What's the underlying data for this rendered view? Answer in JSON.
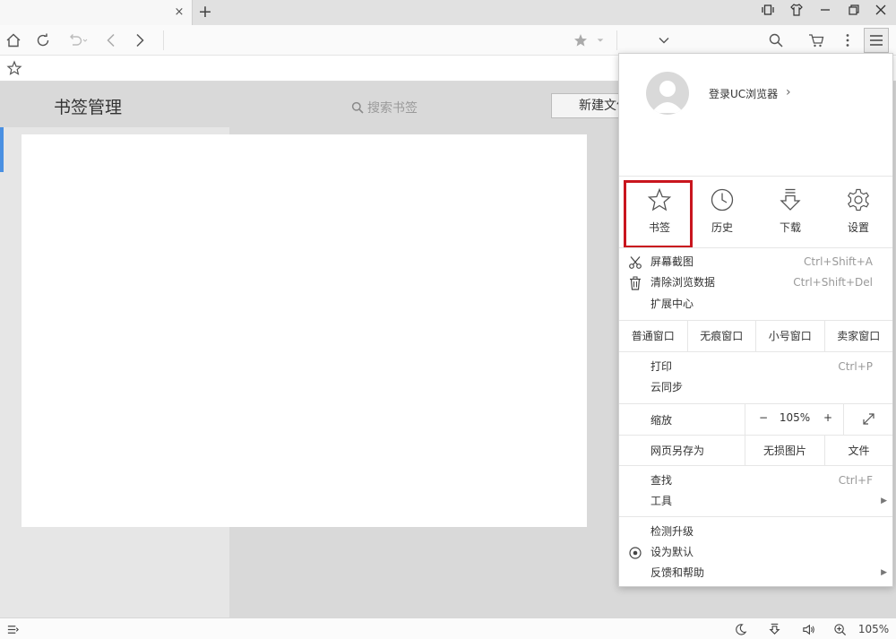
{
  "tabbar": {
    "tab_title": "",
    "close_glyph": "×",
    "new_tab_glyph": "+"
  },
  "navbar": {
    "address": "",
    "icons": [
      "home-icon",
      "refresh-icon",
      "undo-icon",
      "back-icon",
      "forward-icon",
      "star-icon",
      "search-icon",
      "cart-icon",
      "more-icon",
      "hamburger-icon"
    ]
  },
  "page": {
    "title": "书签管理",
    "search_placeholder": "搜索书签",
    "new_folder_label": "新建文件夹"
  },
  "menu": {
    "login_label": "登录UC浏览器",
    "quick_actions": [
      {
        "label": "书签",
        "icon": "star-icon"
      },
      {
        "label": "历史",
        "icon": "clock-icon"
      },
      {
        "label": "下载",
        "icon": "download-icon"
      },
      {
        "label": "设置",
        "icon": "gear-icon"
      }
    ],
    "screenshot": {
      "label": "屏幕截图",
      "shortcut": "Ctrl+Shift+A"
    },
    "clear_data": {
      "label": "清除浏览数据",
      "shortcut": "Ctrl+Shift+Del"
    },
    "extensions": {
      "label": "扩展中心"
    },
    "windows": [
      "普通窗口",
      "无痕窗口",
      "小号窗口",
      "卖家窗口"
    ],
    "print": {
      "label": "打印",
      "shortcut": "Ctrl+P"
    },
    "sync": {
      "label": "云同步"
    },
    "zoom": {
      "label": "缩放",
      "minus": "−",
      "value": "105%",
      "plus": "+"
    },
    "save_page": {
      "label": "网页另存为",
      "opt1": "无损图片",
      "opt2": "文件"
    },
    "find": {
      "label": "查找",
      "shortcut": "Ctrl+F"
    },
    "tools": {
      "label": "工具"
    },
    "check_update": {
      "label": "检测升级"
    },
    "set_default": {
      "label": "设为默认"
    },
    "feedback": {
      "label": "反馈和帮助"
    }
  },
  "statusbar": {
    "zoom": "105%"
  },
  "colors": {
    "highlight": "#c9151e",
    "accent": "#4a90e2"
  }
}
